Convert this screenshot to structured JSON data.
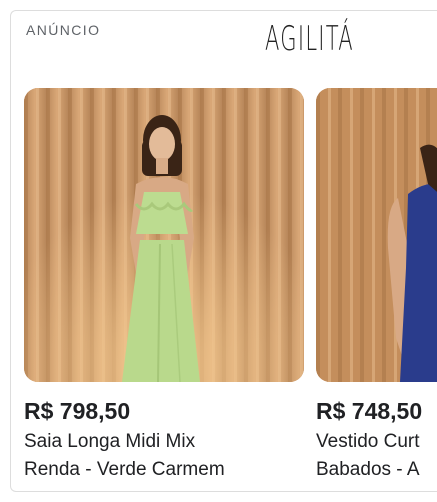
{
  "ad": {
    "label": "ANÚNCIO",
    "brand": "AGILITÁ"
  },
  "products": [
    {
      "price": "R$ 798,50",
      "title_line1": "Saia Longa Midi Mix",
      "title_line2": "Renda - Verde Carmem",
      "image_icon": "green-dress-photo",
      "dress_color": "#b9d98c"
    },
    {
      "price": "R$ 748,50",
      "title_line1": "Vestido Curt",
      "title_line2": "Babados - A",
      "image_icon": "blue-dress-photo",
      "dress_color": "#2a3c8c"
    }
  ],
  "colors": {
    "curtain": "#c9925f",
    "text": "#202124",
    "muted": "#5f6368"
  }
}
